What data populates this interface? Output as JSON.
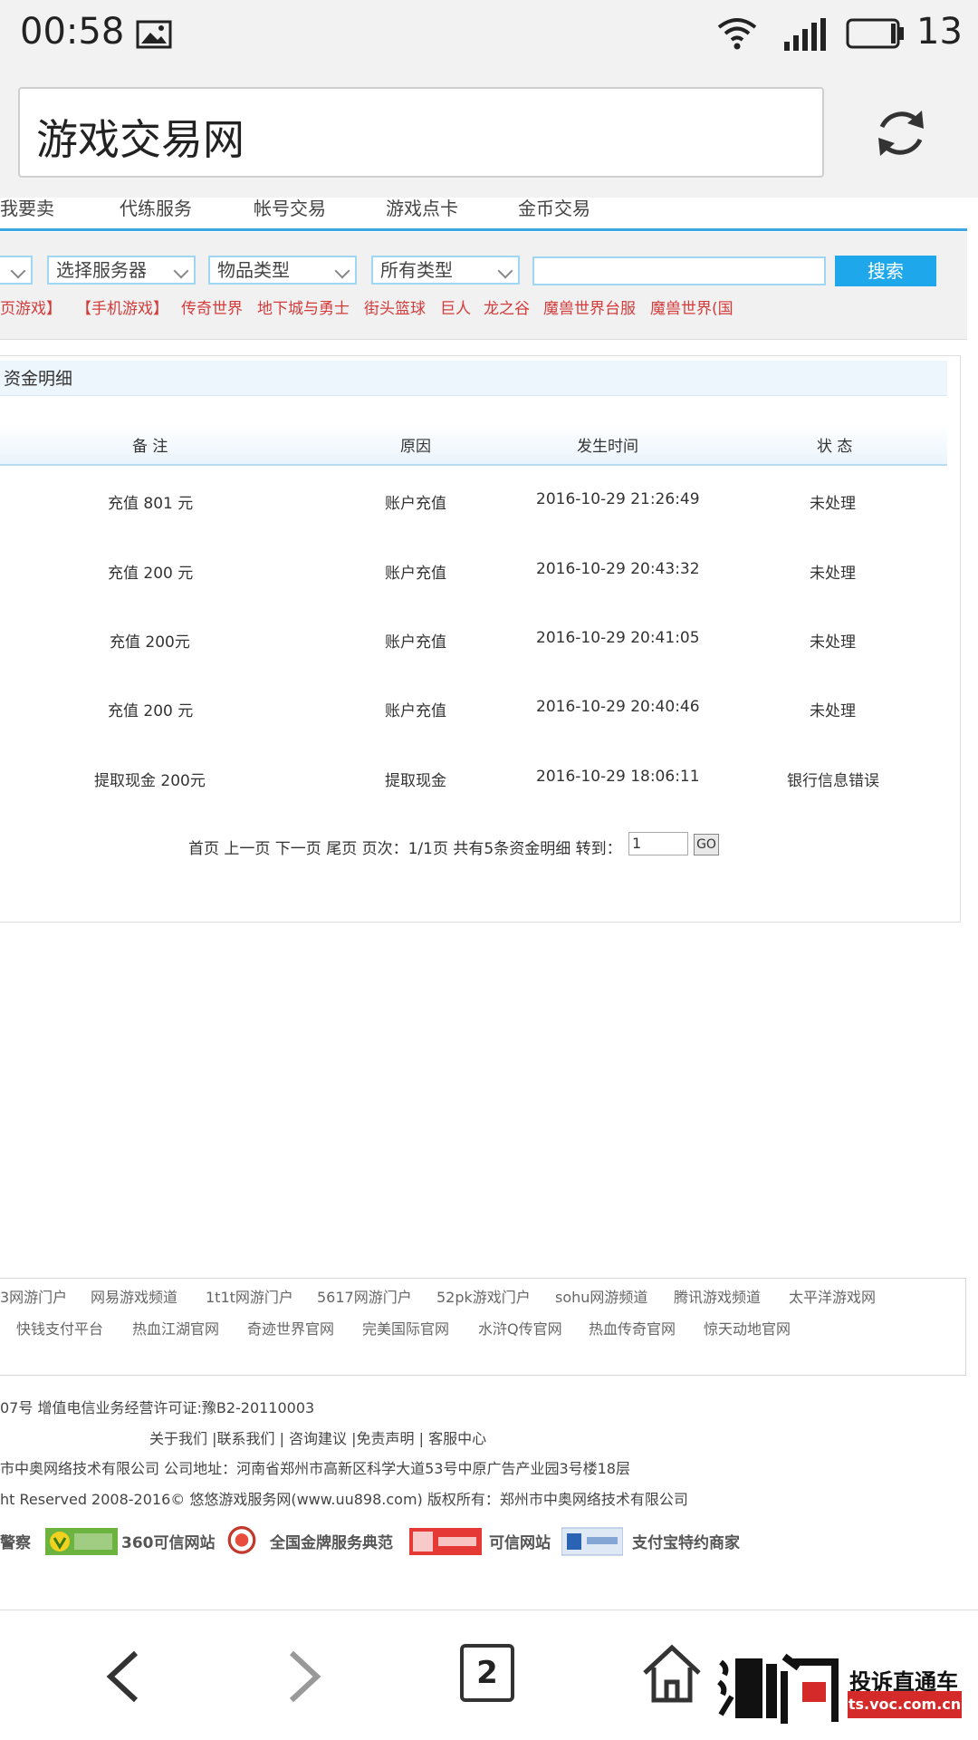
{
  "status_bar": {
    "time": "00:58",
    "battery": "13"
  },
  "address_bar": {
    "title": "游戏交易网"
  },
  "nav": [
    "我要卖",
    "代练服务",
    "帐号交易",
    "游戏点卡",
    "金币交易"
  ],
  "search": {
    "selects": [
      "选择服务器",
      "物品类型",
      "所有类型"
    ],
    "button": "搜索",
    "hot_links": [
      "页游戏】",
      "【手机游戏】",
      "传奇世界",
      "地下城与勇士",
      "街头篮球",
      "巨人",
      "龙之谷",
      "魔兽世界台服",
      "魔兽世界(国"
    ]
  },
  "panel": {
    "title": "资金明细",
    "headers": [
      "备 注",
      "原因",
      "发生时间",
      "状 态"
    ],
    "rows": [
      [
        "充值 801 元",
        "账户充值",
        "2016-10-29 21:26:49",
        "未处理"
      ],
      [
        "充值 200 元",
        "账户充值",
        "2016-10-29 20:43:32",
        "未处理"
      ],
      [
        "充值 200元",
        "账户充值",
        "2016-10-29 20:41:05",
        "未处理"
      ],
      [
        "充值 200 元",
        "账户充值",
        "2016-10-29 20:40:46",
        "未处理"
      ],
      [
        "提取现金 200元",
        "提取现金",
        "2016-10-29 18:06:11",
        "银行信息错误"
      ]
    ],
    "pager": "首页 上一页 下一页 尾页 页次：1/1页 共有5条资金明细 转到：",
    "page_value": "1",
    "go": "GO"
  },
  "footer": {
    "links_row1": [
      "3网游门户",
      "网易游戏频道",
      "1t1t网游门户",
      "5617网游门户",
      "52pk游戏门户",
      "sohu网游频道",
      "腾讯游戏频道",
      "太平洋游戏网"
    ],
    "links_row2": [
      "快钱支付平台",
      "热血江湖官网",
      "奇迹世界官网",
      "完美国际官网",
      "水浒Q传官网",
      "热血传奇官网",
      "惊天动地官网"
    ],
    "license": "07号    增值电信业务经营许可证:豫B2-20110003",
    "about": "关于我们 |联系我们 | 咨询建议 |免责声明 | 客服中心",
    "company": "市中奥网络技术有限公司    公司地址：河南省郑州市高新区科学大道53号中原广告产业园3号楼18层",
    "rights": "ht Reserved 2008-2016© 悠悠游戏服务网(www.uu898.com)    版权所有：郑州市中奥网络技术有限公司",
    "badges": [
      "警察",
      "360可信网站",
      "全国金牌服务典范",
      "可信网站",
      "支付宝特约商家"
    ]
  },
  "bottom_bar": {
    "tabs_count": "2"
  },
  "watermark": {
    "text1": "投诉直通车",
    "text2": "ts.voc.com.cn"
  }
}
